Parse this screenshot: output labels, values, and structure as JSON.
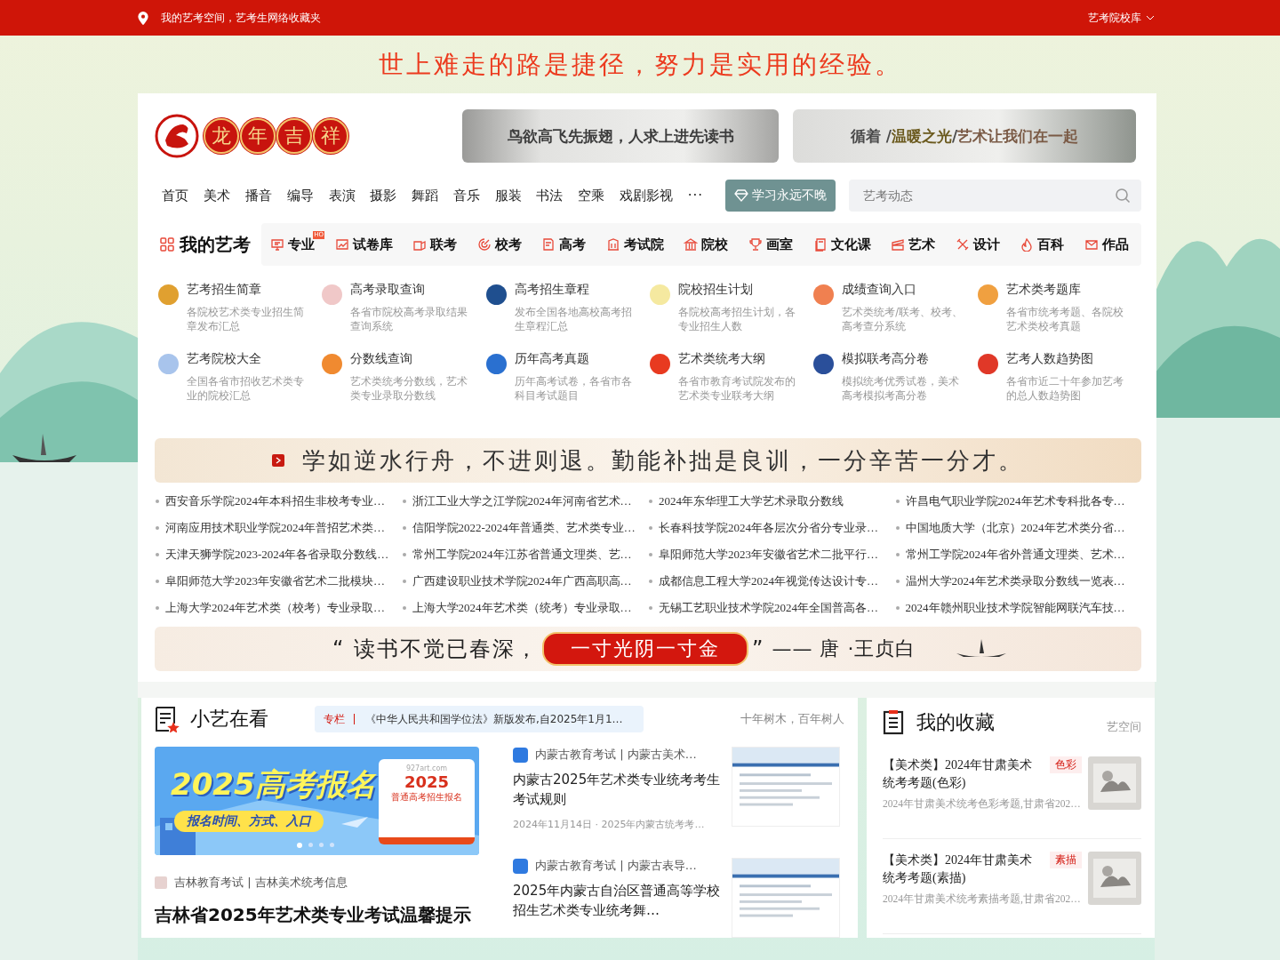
{
  "top_bar": {
    "location": "我的艺考空间，艺考生网络收藏夹",
    "menu": "艺考院校库"
  },
  "slogan": "世上难走的路是捷径，努力是实用的经验。",
  "logo": {
    "chars": [
      "龙",
      "年",
      "吉",
      "祥"
    ]
  },
  "header_banners": [
    {
      "parts": [
        {
          "text": "鸟欲高飞先振翅，人求上进先读书",
          "color": "#3c3c3c"
        }
      ]
    },
    {
      "parts": [
        {
          "text": "循着 / ",
          "color": "#4a4a4a"
        },
        {
          "text": "温暖之光",
          "color": "#6b5a1e"
        },
        {
          "text": " / ",
          "color": "#4a4a4a"
        },
        {
          "text": "艺术让我们在一起",
          "color": "#7a5a45"
        }
      ]
    }
  ],
  "nav": {
    "items": [
      "首页",
      "美术",
      "播音",
      "编导",
      "表演",
      "摄影",
      "舞蹈",
      "音乐",
      "服装",
      "书法",
      "空乘",
      "戏剧影视"
    ],
    "more": "···",
    "promo_button": "学习永远不晚",
    "search": {
      "placeholder": "艺考动态"
    }
  },
  "categories": {
    "title": "我的艺考",
    "items": [
      {
        "label": "专业",
        "kind": "monitor",
        "badge": "HO"
      },
      {
        "label": "试卷库",
        "kind": "chart"
      },
      {
        "label": "联考",
        "kind": "card"
      },
      {
        "label": "校考",
        "kind": "target"
      },
      {
        "label": "高考",
        "kind": "document"
      },
      {
        "label": "考试院",
        "kind": "building"
      },
      {
        "label": "院校",
        "kind": "bank"
      },
      {
        "label": "画室",
        "kind": "trophy"
      },
      {
        "label": "文化课",
        "kind": "book"
      },
      {
        "label": "艺术",
        "kind": "clapper"
      },
      {
        "label": "设计",
        "kind": "tools"
      },
      {
        "label": "百科",
        "kind": "flame"
      },
      {
        "label": "作品",
        "kind": "mail"
      }
    ]
  },
  "quick_links": [
    {
      "title": "艺考招生简章",
      "desc": "各院校艺术类专业招生简章发布汇总",
      "color": "#e0a030"
    },
    {
      "title": "高考录取查询",
      "desc": "各省市院校高考录取结果查询系统",
      "color": "#f0c8c8"
    },
    {
      "title": "高考招生章程",
      "desc": "发布全国各地高校高考招生章程汇总",
      "color": "#1f4f8f"
    },
    {
      "title": "院校招生计划",
      "desc": "各院校高考招生计划，各专业招生人数",
      "color": "#f5e9a0"
    },
    {
      "title": "成绩查询入口",
      "desc": "艺术类统考/联考、校考、高考查分系统",
      "color": "#f08050"
    },
    {
      "title": "艺术类考题库",
      "desc": "各省市统考考题、各院校艺术类校考真题",
      "color": "#f0a040"
    },
    {
      "title": "艺考院校大全",
      "desc": "全国各省市招收艺术类专业的院校汇总",
      "color": "#a8c4ec"
    },
    {
      "title": "分数线查询",
      "desc": "艺术类统考分数线，艺术类专业录取分数线",
      "color": "#f08a30"
    },
    {
      "title": "历年高考真题",
      "desc": "历年高考试卷，各省市各科目考试题目",
      "color": "#2a70d0"
    },
    {
      "title": "艺术类统考大纲",
      "desc": "各省市教育考试院发布的艺术类专业联考大纲",
      "color": "#e83a20"
    },
    {
      "title": "模拟联考高分卷",
      "desc": "模拟统考优秀试卷，美术高考模拟考高分卷",
      "color": "#2a4f9a"
    },
    {
      "title": "艺考人数趋势图",
      "desc": "各省市近二十年参加艺考的总人数趋势图",
      "color": "#e03828"
    }
  ],
  "motto_banner": "学如逆水行舟，不进则退。勤能补拙是良训，一分辛苦一分才。",
  "articles": [
    "西安音乐学院2024年本科招生非校考专业…",
    "浙江工业大学之江学院2024年河南省艺术…",
    "2024年东华理工大学艺术录取分数线",
    "许昌电气职业学院2024年艺术专科批各专…",
    "河南应用技术职业学院2024年普招艺术类…",
    "信阳学院2022-2024年普通类、艺术类专业…",
    "长春科技学院2024年各层次分省分专业录…",
    "中国地质大学（北京）2024年艺术类分省…",
    "天津天狮学院2023-2024年各省录取分数线…",
    "常州工学院2024年江苏省普通文理类、艺…",
    "阜阳师范大学2023年安徽省艺术二批平行…",
    "常州工学院2024年省外普通文理类、艺术…",
    "阜阳师范大学2023年安徽省艺术二批模块…",
    "广西建设职业技术学院2024年广西高职高…",
    "成都信息工程大学2024年视觉传达设计专…",
    "温州大学2024年艺术类录取分数线一览表…",
    "上海大学2024年艺术类（校考）专业录取…",
    "上海大学2024年艺术类（统考）专业录取…",
    "无锡工艺职业技术学院2024年全国普高各…",
    "2024年赣州职业技术学院智能网联汽车技…"
  ],
  "poem_banner": {
    "line": "“ 读书不觉已春深，",
    "highlight": "一寸光阴一寸金",
    "close_quote": "”",
    "author": "—— 唐 ·王贞白"
  },
  "watching": {
    "title": "小艺在看",
    "column_tag": "专栏",
    "column_text": "《中华人民共和国学位法》新版发布,自2025年1月1…",
    "motto": "十年树木，百年树人",
    "carousel": {
      "headline": "2025高考报名",
      "subline": "报名时间、方式、入口",
      "site": "927art.com",
      "calendar_year": "2025",
      "calendar_note": "普通高考招生报名",
      "dots": [
        {
          "selected": true
        },
        {
          "selected": false
        },
        {
          "selected": false
        },
        {
          "selected": false
        }
      ]
    },
    "feature": {
      "source": "吉林教育考试 | 吉林美术统考信息",
      "title": "吉林省2025年艺术类专业考试温馨提示"
    },
    "news": [
      {
        "source": "内蒙古教育考试 | 内蒙古美术…",
        "title": "内蒙古2025年艺术类专业统考考生考试规则",
        "meta": "2024年11月14日 · 2025年内蒙古统考考…"
      },
      {
        "source": "内蒙古教育考试 | 内蒙古表导…",
        "title": "2025年内蒙古自治区普通高等学校招生艺术类专业统考舞…"
      }
    ]
  },
  "favorites": {
    "title": "我的收藏",
    "more": "艺空间",
    "items": [
      {
        "title": "【美术类】2024年甘肃美术统考考题(色彩)",
        "tag": "色彩",
        "desc": "2024年甘肃美术统考色彩考题,甘肃省202…"
      },
      {
        "title": "【美术类】2024年甘肃美术统考考题(素描)",
        "tag": "素描",
        "desc": "2024年甘肃美术统考素描考题,甘肃省202…"
      }
    ]
  }
}
